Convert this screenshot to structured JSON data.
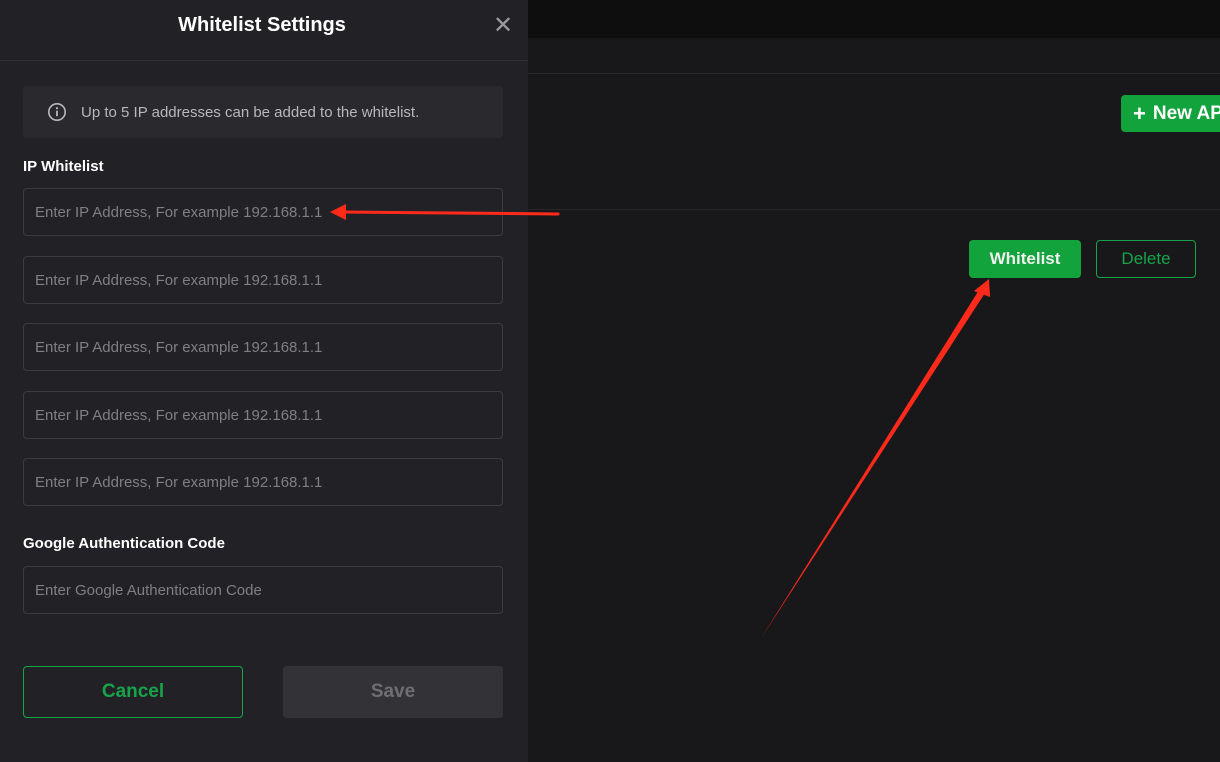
{
  "modal": {
    "title": "Whitelist Settings",
    "close_icon": "close-icon",
    "info_icon": "info-circle-icon",
    "info_text": "Up to 5 IP addresses can be added to the whitelist.",
    "ip_section_label": "IP Whitelist",
    "ip_fields": [
      {
        "value": "",
        "placeholder": "Enter IP Address, For example 192.168.1.1"
      },
      {
        "value": "",
        "placeholder": "Enter IP Address, For example 192.168.1.1"
      },
      {
        "value": "",
        "placeholder": "Enter IP Address, For example 192.168.1.1"
      },
      {
        "value": "",
        "placeholder": "Enter IP Address, For example 192.168.1.1"
      },
      {
        "value": "",
        "placeholder": "Enter IP Address, For example 192.168.1.1"
      }
    ],
    "google_auth_label": "Google Authentication Code",
    "google_auth_field": {
      "value": "",
      "placeholder": "Enter Google Authentication Code"
    },
    "cancel_label": "Cancel",
    "save_label": "Save"
  },
  "background": {
    "new_api_label": "New API",
    "whitelist_label": "Whitelist",
    "delete_label": "Delete"
  },
  "colors": {
    "accent_green": "#16a34a",
    "button_green": "#12a33c",
    "annotation_red": "#ff2a1a",
    "modal_bg": "#222226",
    "page_bg": "#18181a"
  }
}
